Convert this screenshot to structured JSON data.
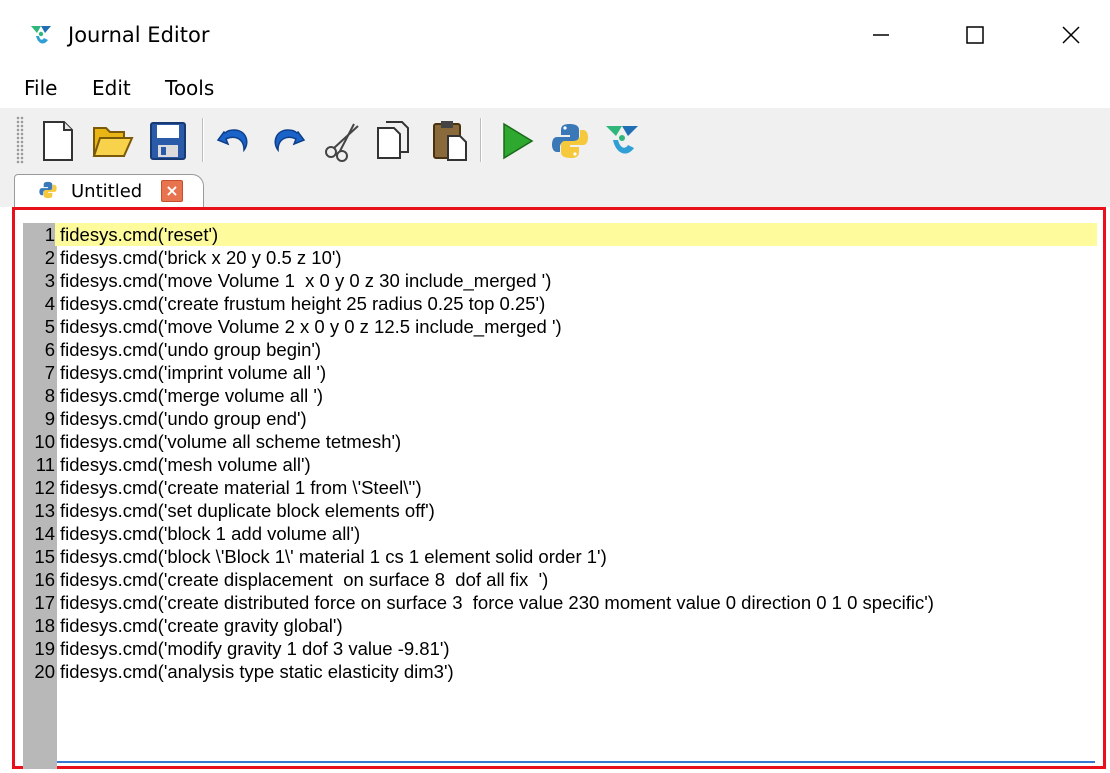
{
  "window": {
    "title": "Journal Editor",
    "minimize_glyph": "—",
    "maximize_glyph": "☐",
    "close_glyph": "✕"
  },
  "menu": {
    "items": [
      {
        "label": "File"
      },
      {
        "label": "Edit"
      },
      {
        "label": "Tools"
      }
    ]
  },
  "toolbar": {
    "buttons": [
      {
        "icon": "new-file-icon"
      },
      {
        "icon": "open-folder-icon"
      },
      {
        "icon": "save-icon"
      },
      {
        "icon": "undo-icon"
      },
      {
        "icon": "redo-icon"
      },
      {
        "icon": "cut-icon"
      },
      {
        "icon": "copy-icon"
      },
      {
        "icon": "paste-icon"
      },
      {
        "icon": "run-icon"
      },
      {
        "icon": "python-icon"
      },
      {
        "icon": "fidesys-icon"
      }
    ]
  },
  "tabs": [
    {
      "label": "Untitled",
      "close_glyph": "×"
    }
  ],
  "editor": {
    "current_line": 1,
    "lines": [
      {
        "n": "1",
        "text": "fidesys.cmd('reset')"
      },
      {
        "n": "2",
        "text": "fidesys.cmd('brick x 20 y 0.5 z 10')"
      },
      {
        "n": "3",
        "text": "fidesys.cmd('move Volume 1  x 0 y 0 z 30 include_merged ')"
      },
      {
        "n": "4",
        "text": "fidesys.cmd('create frustum height 25 radius 0.25 top 0.25')"
      },
      {
        "n": "5",
        "text": "fidesys.cmd('move Volume 2 x 0 y 0 z 12.5 include_merged ')"
      },
      {
        "n": "6",
        "text": "fidesys.cmd('undo group begin')"
      },
      {
        "n": "7",
        "text": "fidesys.cmd('imprint volume all ')"
      },
      {
        "n": "8",
        "text": "fidesys.cmd('merge volume all ')"
      },
      {
        "n": "9",
        "text": "fidesys.cmd('undo group end')"
      },
      {
        "n": "10",
        "text": "fidesys.cmd('volume all scheme tetmesh')"
      },
      {
        "n": "11",
        "text": "fidesys.cmd('mesh volume all')"
      },
      {
        "n": "12",
        "text": "fidesys.cmd('create material 1 from \\'Steel\\'')"
      },
      {
        "n": "13",
        "text": "fidesys.cmd('set duplicate block elements off')"
      },
      {
        "n": "14",
        "text": "fidesys.cmd('block 1 add volume all')"
      },
      {
        "n": "15",
        "text": "fidesys.cmd('block \\'Block 1\\' material 1 cs 1 element solid order 1')"
      },
      {
        "n": "16",
        "text": "fidesys.cmd('create displacement  on surface 8  dof all fix  ')"
      },
      {
        "n": "17",
        "text": "fidesys.cmd('create distributed force on surface 3  force value 230 moment value 0 direction 0 1 0 specific')"
      },
      {
        "n": "18",
        "text": "fidesys.cmd('create gravity global')"
      },
      {
        "n": "19",
        "text": "fidesys.cmd('modify gravity 1 dof 3 value -9.81')"
      },
      {
        "n": "20",
        "text": "fidesys.cmd('analysis type static elasticity dim3')"
      }
    ]
  },
  "colors": {
    "current_line_highlight": "#fdfb9c",
    "editor_border": "#e8101a",
    "gutter": "#b8b8b8",
    "run_green": "#2ea82e",
    "undo_blue": "#1a63c9"
  }
}
